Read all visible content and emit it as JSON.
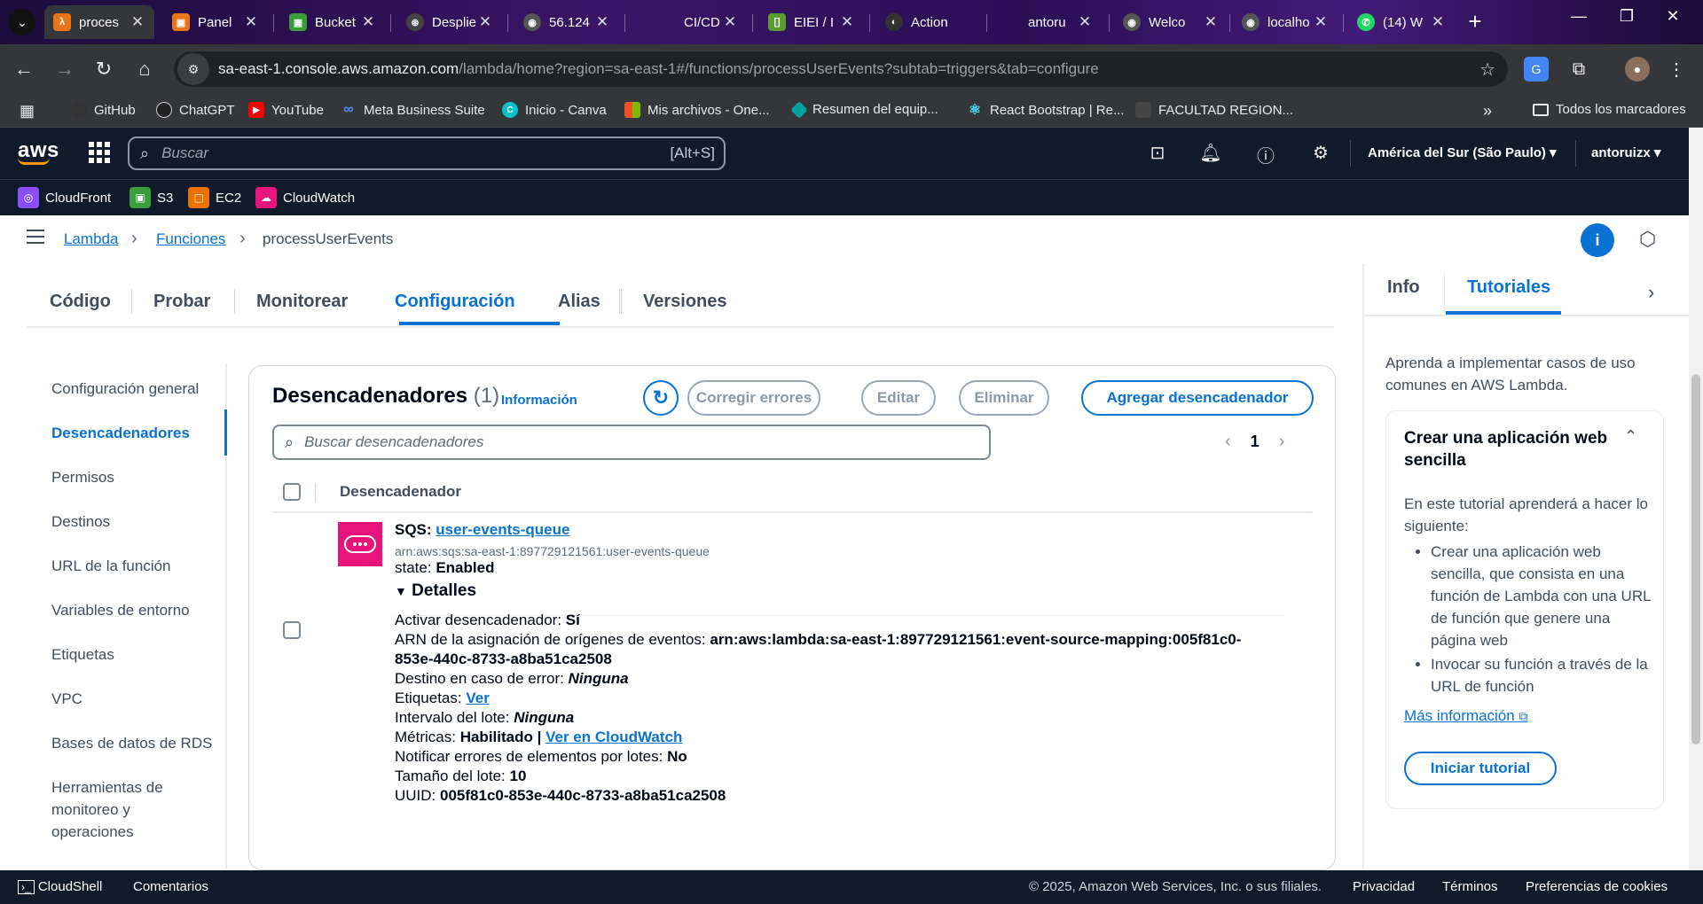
{
  "browser": {
    "tabs": [
      {
        "title": "proces",
        "icon": "λ",
        "color": "#e8751a"
      },
      {
        "title": "Panel",
        "icon": "▣",
        "color": "#e8751a"
      },
      {
        "title": "Bucket",
        "icon": "▣",
        "color": "#3b9c3b"
      },
      {
        "title": "Desplie",
        "icon": "⊛",
        "color": "#444"
      },
      {
        "title": "56.124",
        "icon": "◉",
        "color": "#555"
      },
      {
        "title": "CI/CD",
        "icon": "",
        "color": "transparent"
      },
      {
        "title": "EIEI / I",
        "icon": "[]",
        "color": "#5a9b2f"
      },
      {
        "title": "Action",
        "icon": "◐",
        "color": "#333"
      },
      {
        "title": "antoru",
        "icon": "",
        "color": "transparent"
      },
      {
        "title": "Welco",
        "icon": "◉",
        "color": "#555"
      },
      {
        "title": "localho",
        "icon": "◉",
        "color": "#555"
      },
      {
        "title": "(14) W",
        "icon": "✆",
        "color": "#25d366"
      }
    ],
    "url_host": "sa-east-1.console.aws.amazon.com",
    "url_path": "/lambda/home?region=sa-east-1#/functions/processUserEvents?subtab=triggers&tab=configure",
    "bookmarks": [
      {
        "label": "GitHub",
        "color": "#333"
      },
      {
        "label": "ChatGPT",
        "color": "#222"
      },
      {
        "label": "YouTube",
        "color": "#ff0000"
      },
      {
        "label": "Meta Business Suite",
        "color": "#0866ff"
      },
      {
        "label": "Inicio - Canva",
        "color": "#00c4cc"
      },
      {
        "label": "Mis archivos - One...",
        "color": "#f25022"
      },
      {
        "label": "Resumen del equip...",
        "color": "#00a39a"
      },
      {
        "label": "React Bootstrap | Re...",
        "color": "#41e0fd"
      },
      {
        "label": "FACULTAD REGION...",
        "color": "#444"
      }
    ],
    "all_bookmarks": "Todos los marcadores"
  },
  "aws": {
    "logo": "aws",
    "search_placeholder": "Buscar",
    "search_hotkey": "[Alt+S]",
    "region": "América del Sur (São Paulo)",
    "user": "antoruizx",
    "favorites": [
      {
        "label": "CloudFront",
        "color": "#8c4fff"
      },
      {
        "label": "S3",
        "color": "#3b9c3b"
      },
      {
        "label": "EC2",
        "color": "#ed7100"
      },
      {
        "label": "CloudWatch",
        "color": "#e7157b"
      }
    ]
  },
  "breadcrumb": {
    "lambda": "Lambda",
    "funciones": "Funciones",
    "current": "processUserEvents"
  },
  "function_tabs": [
    "Código",
    "Probar",
    "Monitorear",
    "Configuración",
    "Alias",
    "Versiones"
  ],
  "sidenav": [
    "Configuración general",
    "Desencadenadores",
    "Permisos",
    "Destinos",
    "URL de la función",
    "Variables de entorno",
    "Etiquetas",
    "VPC",
    "Bases de datos de RDS",
    "Herramientas de monitoreo y operaciones"
  ],
  "triggers": {
    "title": "Desencadenadores",
    "count": "(1)",
    "info_link": "Información",
    "buttons": {
      "fix": "Corregir errores",
      "edit": "Editar",
      "delete": "Eliminar",
      "add": "Agregar desencadenador"
    },
    "search_placeholder": "Buscar desencadenadores",
    "page": "1",
    "column": "Desencadenador",
    "row": {
      "type": "SQS:",
      "queue": "user-events-queue",
      "arn": "arn:aws:sqs:sa-east-1:897729121561:user-events-queue",
      "state_label": "state:",
      "state_value": "Enabled",
      "details_label": "Detalles",
      "activate_label": "Activar desencadenador:",
      "activate_value": "Sí",
      "esm_label": "ARN de la asignación de orígenes de eventos:",
      "esm_value_1": "arn:aws:lambda:sa-east-1:897729121561:event-source-mapping:005f81c0-",
      "esm_value_2": "853e-440c-8733-a8ba51ca2508",
      "dest_label": "Destino en caso de error:",
      "dest_value": "Ninguna",
      "tags_label": "Etiquetas:",
      "tags_link": "Ver",
      "batch_window_label": "Intervalo del lote:",
      "batch_window_value": "Ninguna",
      "metrics_label": "Métricas:",
      "metrics_value": "Habilitado |",
      "metrics_link": "Ver en CloudWatch",
      "report_label": "Notificar errores de elementos por lotes:",
      "report_value": "No",
      "batch_size_label": "Tamaño del lote:",
      "batch_size_value": "10",
      "uuid_label": "UUID:",
      "uuid_value": "005f81c0-853e-440c-8733-a8ba51ca2508"
    }
  },
  "help": {
    "tab_info": "Info",
    "tab_tutorials": "Tutoriales",
    "intro": "Aprenda a implementar casos de uso comunes en AWS Lambda.",
    "card_title": "Crear una aplicación web sencilla",
    "card_intro": "En este tutorial aprenderá a hacer lo siguiente:",
    "bullets": [
      "Crear una aplicación web sencilla, que consista en una función de Lambda con una URL de función que genere una página web",
      "Invocar su función a través de la URL de función"
    ],
    "more_link": "Más información",
    "start_button": "Iniciar tutorial"
  },
  "footer": {
    "cloudshell": "CloudShell",
    "feedback": "Comentarios",
    "copyright": "© 2025, Amazon Web Services, Inc. o sus filiales.",
    "privacy": "Privacidad",
    "terms": "Términos",
    "cookies": "Preferencias de cookies"
  }
}
